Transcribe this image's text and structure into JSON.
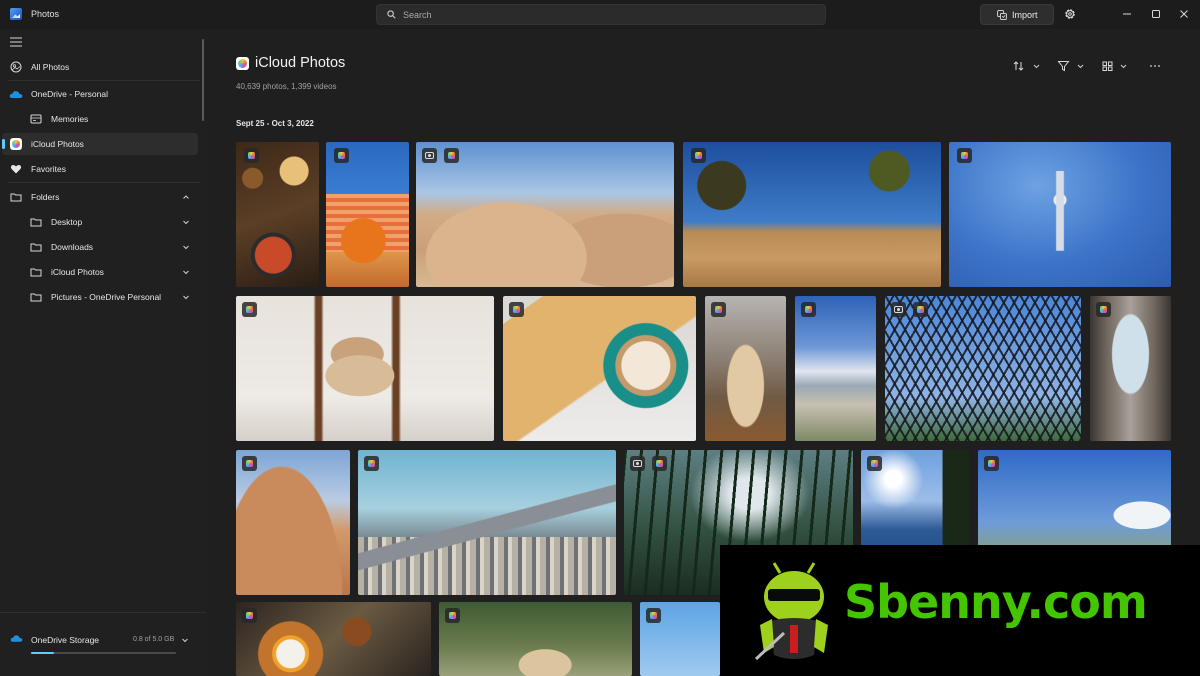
{
  "window": {
    "app_title": "Photos",
    "search_placeholder": "Search",
    "import_label": "Import"
  },
  "sidebar": {
    "items": [
      {
        "label": "All Photos",
        "icon": "all-photos-icon"
      },
      {
        "label": "OneDrive - Personal",
        "icon": "onedrive-cloud-icon"
      },
      {
        "label": "Memories",
        "icon": "memories-icon"
      },
      {
        "label": "iCloud Photos",
        "icon": "icloud-photos-icon",
        "selected": true
      },
      {
        "label": "Favorites",
        "icon": "heart-icon"
      },
      {
        "label": "Folders",
        "icon": "folder-icon"
      },
      {
        "label": "Desktop",
        "icon": "folder-icon"
      },
      {
        "label": "Downloads",
        "icon": "folder-icon"
      },
      {
        "label": "iCloud Photos",
        "icon": "folder-icon"
      },
      {
        "label": "Pictures - OneDrive Personal",
        "icon": "folder-icon"
      }
    ],
    "storage": {
      "label": "OneDrive Storage",
      "used_text": "0.8 of 5.0 GB",
      "used_fraction": 0.16
    }
  },
  "main": {
    "title": "iCloud Photos",
    "subtitle": "40,639 photos, 1,399 videos",
    "date_range": "Sept 25 - Oct 3, 2022",
    "accent_color": "#60cdff"
  },
  "watermark": {
    "text": "Sbenny.com",
    "color": "#45c400"
  }
}
